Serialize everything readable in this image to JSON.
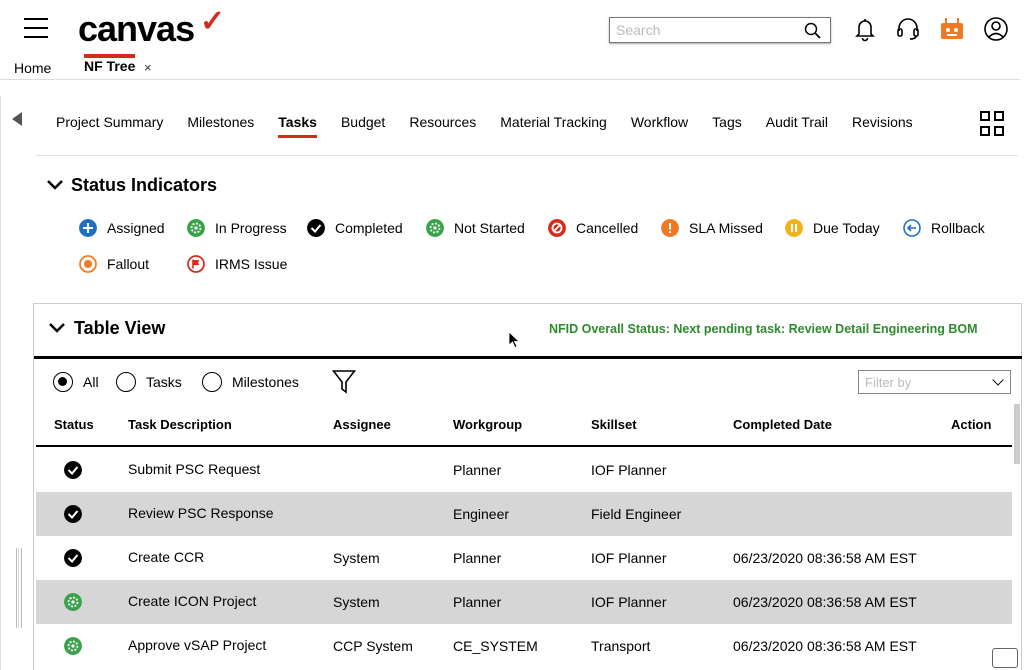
{
  "header": {
    "logo": "canvas",
    "search_placeholder": "Search",
    "icons": [
      "bell-icon",
      "headset-icon",
      "robot-icon",
      "user-icon"
    ],
    "brand_color": "#d52b1e"
  },
  "breadcrumb": {
    "home": "Home",
    "tab": "NF Tree",
    "close": "×"
  },
  "nav": {
    "tabs": [
      "Project Summary",
      "Milestones",
      "Tasks",
      "Budget",
      "Resources",
      "Material Tracking",
      "Workflow",
      "Tags",
      "Audit Trail",
      "Revisions"
    ],
    "active": "Tasks"
  },
  "status_indicators": {
    "title": "Status Indicators",
    "items": [
      {
        "label": "Assigned",
        "icon": "plus-circle-icon",
        "color": "#1f6fc5"
      },
      {
        "label": "In Progress",
        "icon": "gear-circle-icon",
        "color": "#3aa24a"
      },
      {
        "label": "Completed",
        "icon": "check-circle-icon",
        "color": "#000000"
      },
      {
        "label": "Not Started",
        "icon": "gear-circle-icon",
        "color": "#3aa24a"
      },
      {
        "label": "Cancelled",
        "icon": "ban-circle-icon",
        "color": "#d52b1e"
      },
      {
        "label": "SLA Missed",
        "icon": "exclamation-circle-icon",
        "color": "#f07a24"
      },
      {
        "label": "Due Today",
        "icon": "pause-circle-icon",
        "color": "#f2b21b"
      },
      {
        "label": "Rollback",
        "icon": "arrow-left-circle-icon",
        "color": "#1f6fc5"
      },
      {
        "label": "Fallout",
        "icon": "dot-circle-icon",
        "color": "#f07a24"
      },
      {
        "label": "IRMS Issue",
        "icon": "flag-circle-icon",
        "color": "#d52b1e"
      }
    ]
  },
  "table_view": {
    "title": "Table View",
    "overall_status": "NFID Overall Status: Next pending task: Review Detail Engineering BOM",
    "filters": {
      "all": "All",
      "tasks": "Tasks",
      "milestones": "Milestones",
      "selected": "All"
    },
    "filter_by_placeholder": "Filter by",
    "columns": [
      "Status",
      "Task Description",
      "Assignee",
      "Workgroup",
      "Skillset",
      "Completed Date",
      "Action"
    ],
    "rows": [
      {
        "status": "completed",
        "task": "Submit PSC Request",
        "assignee": "",
        "workgroup": "Planner",
        "skillset": "IOF Planner",
        "completed": ""
      },
      {
        "status": "completed",
        "task": "Review PSC Response",
        "assignee": "",
        "workgroup": "Engineer",
        "skillset": "Field Engineer",
        "completed": ""
      },
      {
        "status": "completed",
        "task": "Create CCR",
        "assignee": "System",
        "workgroup": "Planner",
        "skillset": "IOF Planner",
        "completed": "06/23/2020 08:36:58 AM EST"
      },
      {
        "status": "in-progress",
        "task": "Create ICON Project",
        "assignee": "System",
        "workgroup": "Planner",
        "skillset": "IOF Planner",
        "completed": "06/23/2020 08:36:58 AM EST"
      },
      {
        "status": "in-progress",
        "task": "Approve vSAP Project",
        "assignee": "CCP System",
        "workgroup": "CE_SYSTEM",
        "skillset": "Transport",
        "completed": "06/23/2020 08:36:58 AM EST"
      }
    ]
  }
}
